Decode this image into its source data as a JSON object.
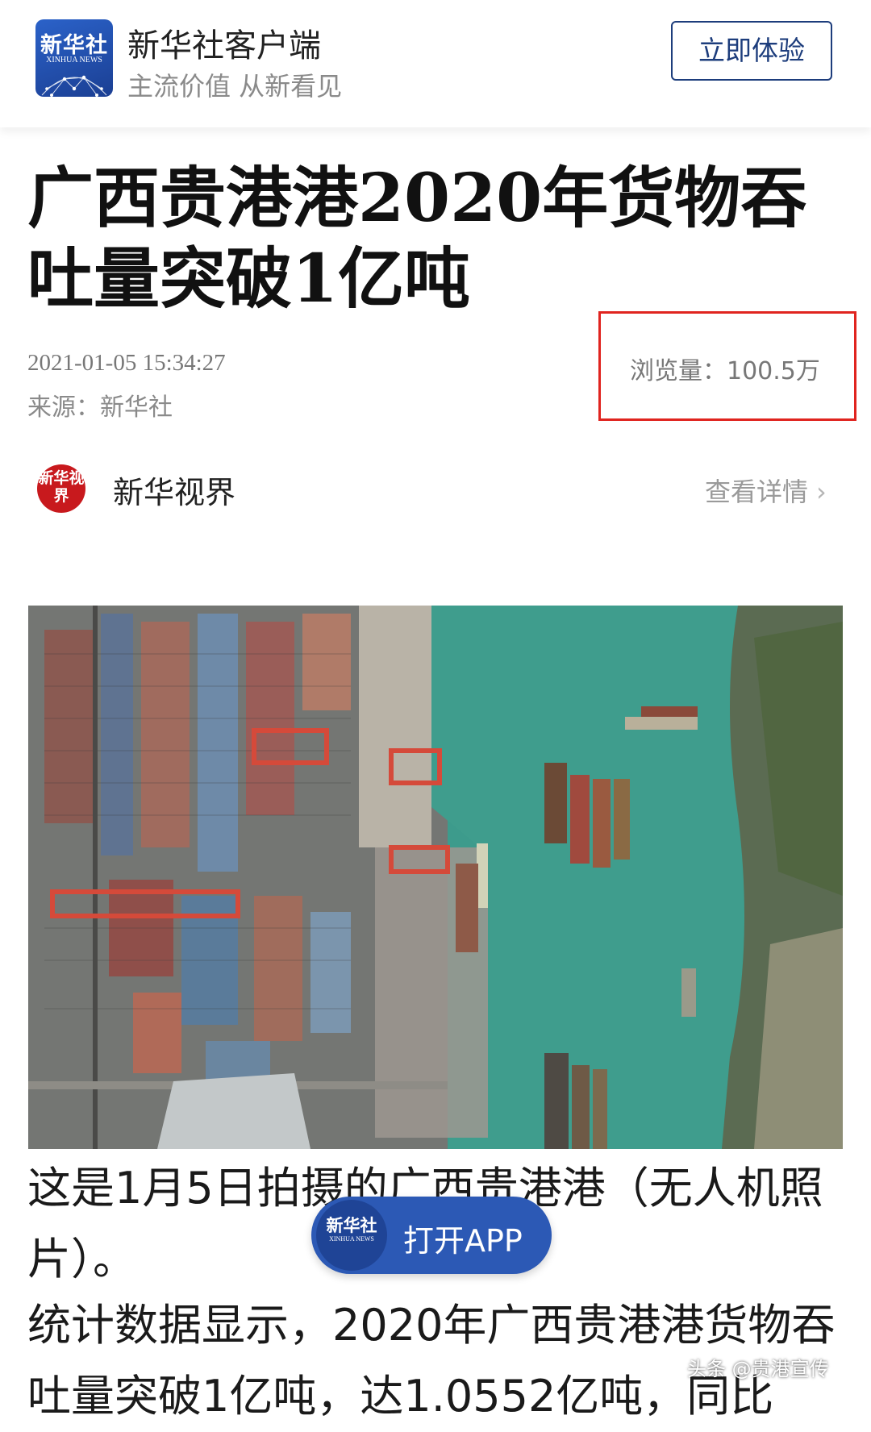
{
  "header": {
    "logo_text": "新华社",
    "logo_subtext": "XINHUA NEWS",
    "app_name": "新华社客户端",
    "slogan": "主流价值 从新看见",
    "try_button": "立即体验"
  },
  "article": {
    "title": "广西贵港港2020年货物吞吐量突破1亿吨",
    "published": "2021-01-05 15:34:27",
    "source": "来源：新华社",
    "views": "浏览量：100.5万",
    "channel": {
      "logo_text": "新华视界",
      "name": "新华视界",
      "detail_link": "查看详情"
    },
    "image_icon": "aerial-port-photo",
    "paragraphs": [
      "这是1月5日拍摄的广西贵港港（无人机照片）。",
      "统计数据显示，2020年广西贵港港货物吞吐量突破1亿吨，达1.0552亿吨，同比"
    ]
  },
  "open_app": {
    "logo_text": "新华社",
    "logo_subtext": "XINHUA NEWS",
    "label": "打开APP"
  },
  "watermark": "头条 @贵港宣传",
  "colors": {
    "brand_blue": "#1d3d7c",
    "button_blue": "#2c59b5",
    "highlight_red": "#e0241f",
    "seal_red": "#c8191d",
    "water_teal": "#3d9b8c"
  }
}
